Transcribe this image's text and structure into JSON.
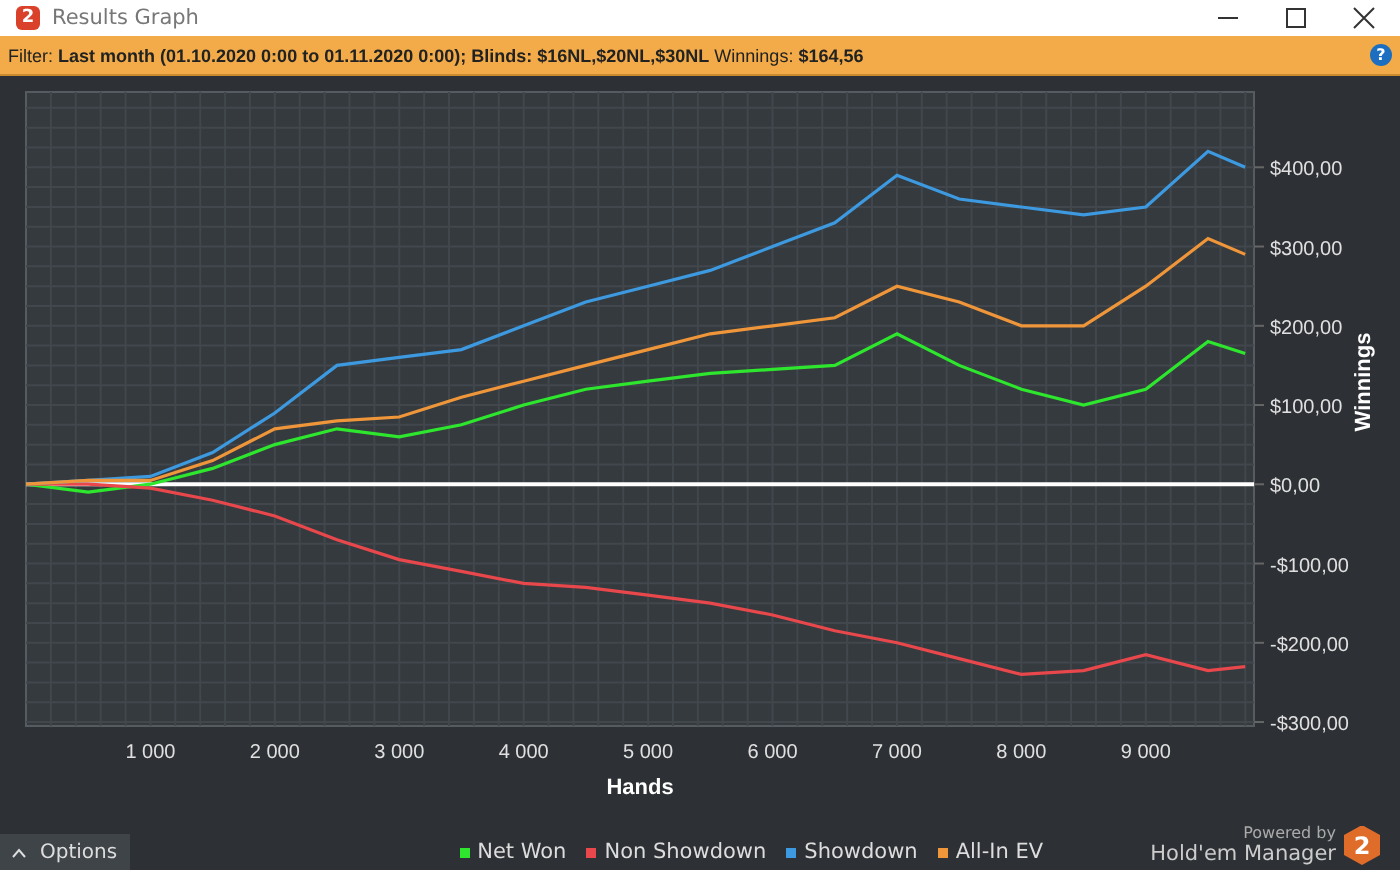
{
  "window": {
    "title": "Results Graph",
    "app_icon_text": "2"
  },
  "filter_bar": {
    "text": "Filter: **Last month (01.10.2020 0:00 to 01.11.2020 0:00); Blinds: $16NL,$20NL,$30NL** Winnings: **$164,56**",
    "help_label": "?"
  },
  "graph": {
    "chart_data": {
      "type": "line",
      "xlabel": "Hands",
      "ylabel": "Winnings",
      "x": [
        0,
        500,
        1000,
        1500,
        2000,
        2500,
        3000,
        3500,
        4000,
        4500,
        5000,
        5500,
        6000,
        6500,
        7000,
        7500,
        8000,
        8500,
        9000,
        9500,
        9800
      ],
      "series": [
        {
          "name": "Net Won",
          "color": "#2ee62e",
          "values": [
            0,
            -10,
            0,
            20,
            50,
            70,
            60,
            75,
            100,
            120,
            130,
            140,
            145,
            150,
            190,
            150,
            120,
            100,
            120,
            180,
            165
          ]
        },
        {
          "name": "Non Showdown",
          "color": "#e8474b",
          "values": [
            0,
            0,
            -5,
            -20,
            -40,
            -70,
            -95,
            -110,
            -125,
            -130,
            -140,
            -150,
            -165,
            -185,
            -200,
            -220,
            -240,
            -235,
            -215,
            -235,
            -230
          ]
        },
        {
          "name": "Showdown",
          "color": "#3d9ae0",
          "values": [
            0,
            5,
            10,
            40,
            90,
            150,
            160,
            170,
            200,
            230,
            250,
            270,
            300,
            330,
            390,
            360,
            350,
            340,
            350,
            420,
            400
          ]
        },
        {
          "name": "All-In EV",
          "color": "#f0963a",
          "values": [
            0,
            5,
            5,
            30,
            70,
            80,
            85,
            110,
            130,
            150,
            170,
            190,
            200,
            210,
            250,
            230,
            200,
            200,
            250,
            310,
            290
          ]
        }
      ],
      "grid": true,
      "xlim": [
        0,
        9870
      ],
      "ylim": [
        -305,
        495
      ],
      "xticks": [
        {
          "value": 1000,
          "label": "1 000"
        },
        {
          "value": 2000,
          "label": "2 000"
        },
        {
          "value": 3000,
          "label": "3 000"
        },
        {
          "value": 4000,
          "label": "4 000"
        },
        {
          "value": 5000,
          "label": "5 000"
        },
        {
          "value": 6000,
          "label": "6 000"
        },
        {
          "value": 7000,
          "label": "7 000"
        },
        {
          "value": 8000,
          "label": "8 000"
        },
        {
          "value": 9000,
          "label": "9 000"
        }
      ],
      "yticks": [
        {
          "value": 400,
          "label": "$400,00"
        },
        {
          "value": 300,
          "label": "$300,00"
        },
        {
          "value": 200,
          "label": "$200,00"
        },
        {
          "value": 100,
          "label": "$100,00"
        },
        {
          "value": 0,
          "label": "$0,00"
        },
        {
          "value": -100,
          "label": "-$100,00"
        },
        {
          "value": -200,
          "label": "-$200,00"
        },
        {
          "value": -300,
          "label": "-$300,00"
        }
      ]
    }
  },
  "options_button": {
    "label": "Options"
  },
  "branding": {
    "powered_by": "Powered by",
    "product": "Hold'em Manager",
    "logo_text": "2"
  }
}
